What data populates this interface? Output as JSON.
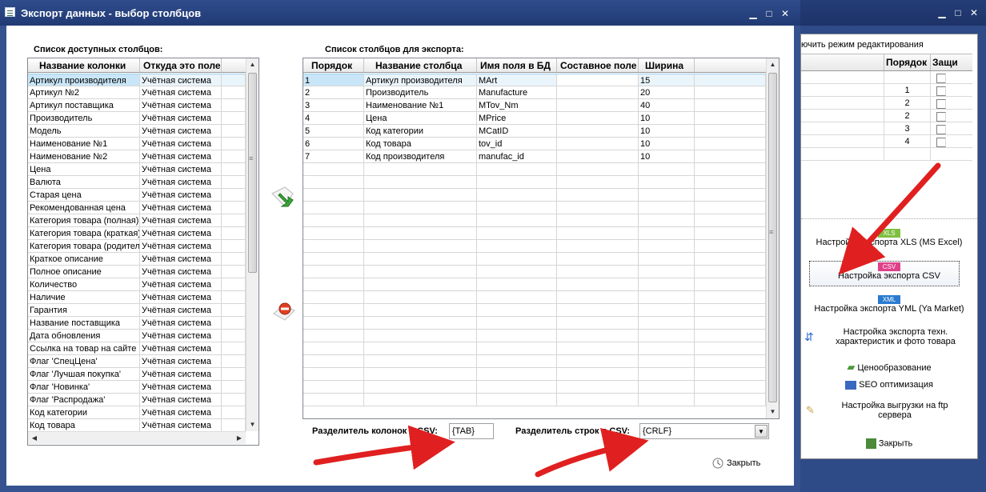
{
  "bg_window": {
    "toolbar_text": "ючить режим редактирования",
    "grid_headers": [
      "",
      "Порядок",
      "Защи"
    ],
    "grid_rows": [
      {
        "order": ""
      },
      {
        "order": "1"
      },
      {
        "order": "2"
      },
      {
        "order": "2"
      },
      {
        "order": "3"
      },
      {
        "order": "4"
      }
    ],
    "menu": {
      "xls_badge": "XLS",
      "xls_label": "Настройка экспорта XLS (MS Excel)",
      "csv_badge": "CSV",
      "csv_label": "Настройка экспорта CSV",
      "xml_badge": "XML",
      "yml_label": "Настройка экспорта YML (Ya Market)",
      "tech_label_1": "Настройка экспорта техн.",
      "tech_label_2": "характеристик и фото товара",
      "pricing_label": "Ценообразование",
      "seo_label": "SEO оптимизация",
      "ftp_label_1": "Настройка выгрузки на ftp",
      "ftp_label_2": "сервера",
      "close_label": "Закрыть"
    }
  },
  "dialog": {
    "title": "Экспорт данных - выбор столбцов",
    "available_caption": "Список доступных столбцов:",
    "export_caption": "Список столбцов для экспорта:",
    "available_headers": [
      "Название колонки",
      "Откуда это поле"
    ],
    "available_rows": [
      [
        "Артикул производителя",
        "Учётная система"
      ],
      [
        "Артикул №2",
        "Учётная система"
      ],
      [
        "Артикул поставщика",
        "Учётная система"
      ],
      [
        "Производитель",
        "Учётная система"
      ],
      [
        "Модель",
        "Учётная система"
      ],
      [
        "Наименование №1",
        "Учётная система"
      ],
      [
        "Наименование №2",
        "Учётная система"
      ],
      [
        "Цена",
        "Учётная система"
      ],
      [
        "Валюта",
        "Учётная система"
      ],
      [
        "Старая цена",
        "Учётная система"
      ],
      [
        "Рекомендованная цена",
        "Учётная система"
      ],
      [
        "Категория товара (полная)",
        "Учётная система"
      ],
      [
        "Категория товара (краткая)",
        "Учётная система"
      ],
      [
        "Категория товара (родитель)",
        "Учётная система"
      ],
      [
        "Краткое описание",
        "Учётная система"
      ],
      [
        "Полное описание",
        "Учётная система"
      ],
      [
        "Количество",
        "Учётная система"
      ],
      [
        "Наличие",
        "Учётная система"
      ],
      [
        "Гарантия",
        "Учётная система"
      ],
      [
        "Название поставщика",
        "Учётная система"
      ],
      [
        "Дата обновления",
        "Учётная система"
      ],
      [
        "Ссылка на товар на сайте",
        "Учётная система"
      ],
      [
        "Флаг 'СпецЦена'",
        "Учётная система"
      ],
      [
        "Флаг 'Лучшая покупка'",
        "Учётная система"
      ],
      [
        "Флаг 'Новинка'",
        "Учётная система"
      ],
      [
        "Флаг 'Распродажа'",
        "Учётная система"
      ],
      [
        "Код категории",
        "Учётная система"
      ],
      [
        "Код товара",
        "Учётная система"
      ]
    ],
    "export_headers": [
      "Порядок",
      "Название столбца",
      "Имя поля в БД",
      "Составное поле",
      "Ширина"
    ],
    "export_rows": [
      [
        "1",
        "Артикул производителя",
        "MArt",
        "",
        "15"
      ],
      [
        "2",
        "Производитель",
        "Manufacture",
        "",
        "20"
      ],
      [
        "3",
        "Наименование №1",
        "MTov_Nm",
        "",
        "40"
      ],
      [
        "4",
        "Цена",
        "MPrice",
        "",
        "10"
      ],
      [
        "5",
        "Код категории",
        "MCatID",
        "",
        "10"
      ],
      [
        "6",
        "Код товара",
        "tov_id",
        "",
        "10"
      ],
      [
        "7",
        "Код производителя",
        "manufac_id",
        "",
        "10"
      ]
    ],
    "col_sep_label": "Разделитель колонок в CSV:",
    "col_sep_value": "{TAB}",
    "row_sep_label": "Разделитель строк в CSV:",
    "row_sep_value": "{CRLF}",
    "close_label": "Закрыть"
  },
  "colors": {
    "title_bar": "#2f4c8c",
    "selection": "#c9e6f8",
    "annotation_arrow": "#e02020",
    "xls_badge": "#7fbf3f",
    "csv_badge": "#e0408a",
    "xml_badge": "#2a7ad0"
  }
}
